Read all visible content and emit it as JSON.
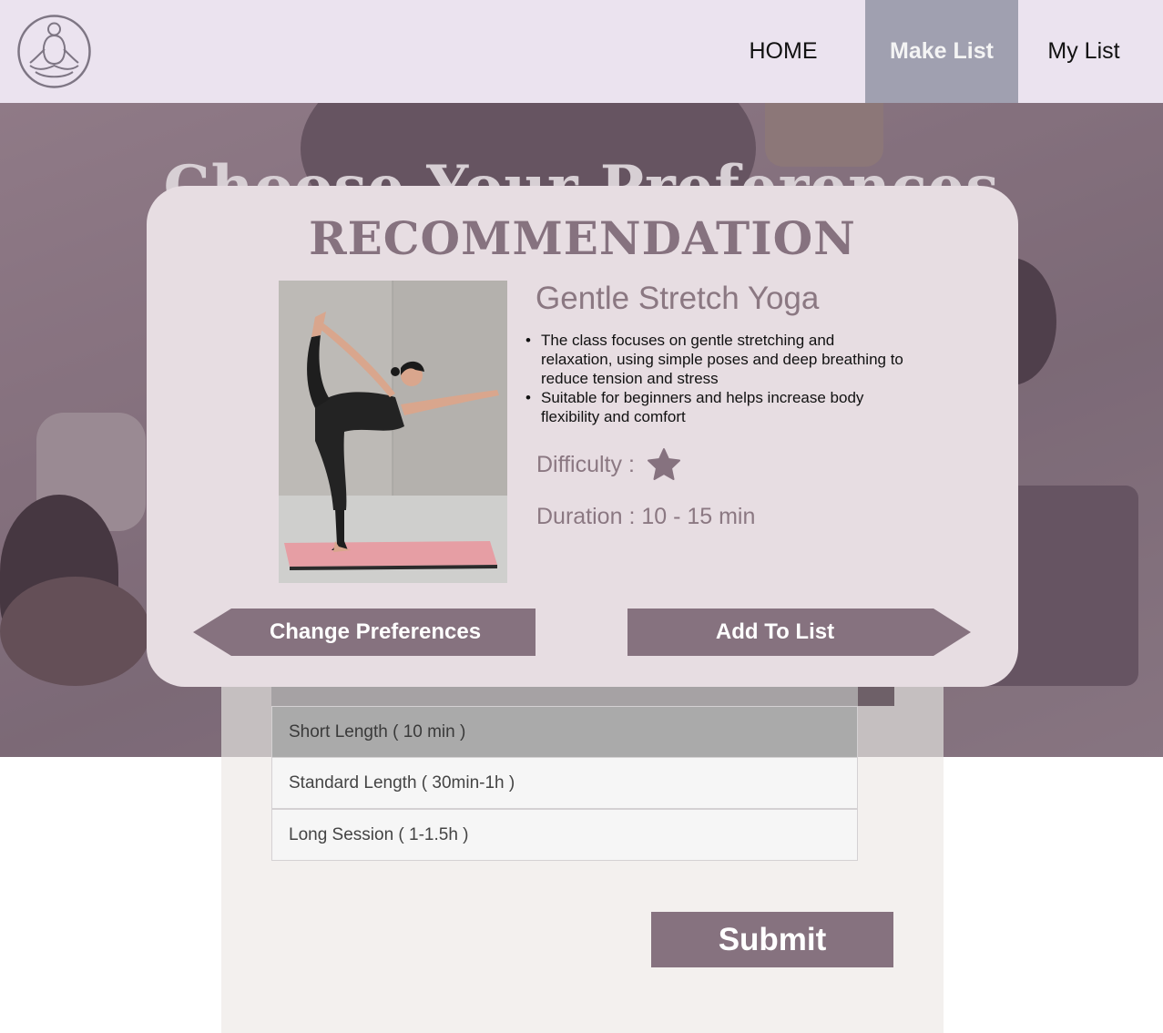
{
  "colors": {
    "header_bg": "#ebe3ef",
    "nav_active_bg": "#a0a0b0",
    "accent": "#86727f",
    "modal_bg": "#e7dde2",
    "muted_text": "#8b7882"
  },
  "header": {
    "logo_icon": "meditation-logo-icon",
    "nav": [
      {
        "label": "HOME",
        "active": false
      },
      {
        "label": "Make List",
        "active": true
      },
      {
        "label": "My List",
        "active": false
      }
    ]
  },
  "background": {
    "title": "Choose Your Preferences"
  },
  "form": {
    "length_options": [
      {
        "label": "Short Length ( 10 min )",
        "selected": true
      },
      {
        "label": "Standard Length ( 30min-1h )",
        "selected": false
      },
      {
        "label": "Long Session ( 1-1.5h )",
        "selected": false
      }
    ],
    "submit_label": "Submit"
  },
  "modal": {
    "title": "RECOMMENDATION",
    "class_name": "Gentle Stretch Yoga",
    "description": [
      "The class focuses on gentle stretching and relaxation, using simple poses and deep breathing to reduce tension and stress",
      "Suitable for beginners and helps increase body flexibility and comfort"
    ],
    "difficulty_label": "Difficulty :",
    "difficulty_stars": 1,
    "duration_label": "Duration : 10 - 15 min",
    "change_button_label": "Change Preferences",
    "add_button_label": "Add To List"
  }
}
